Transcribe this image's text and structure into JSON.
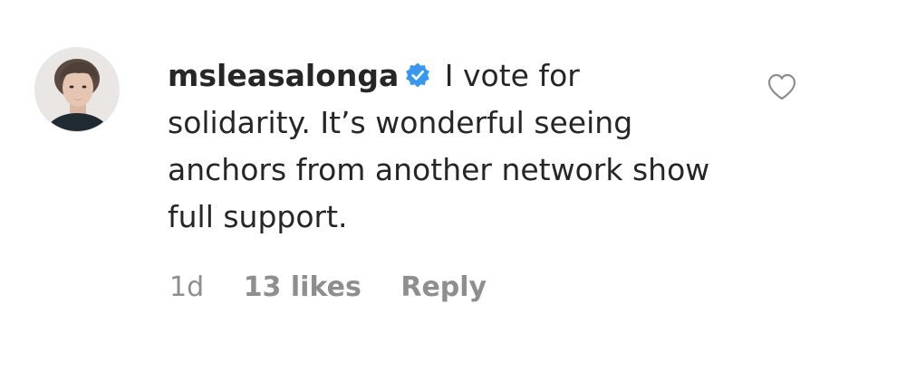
{
  "comment": {
    "username": "msleasalonga",
    "verified": true,
    "text": "I vote for solidarity. It’s wonderful seeing anchors from another network show full support.",
    "time": "1d",
    "likes": "13 likes",
    "reply_label": "Reply"
  },
  "icons": {
    "verified": "verified-badge-icon",
    "like": "heart-outline-icon"
  },
  "colors": {
    "verified_blue": "#3897f0",
    "meta_gray": "#8e8e8e",
    "text": "#262626"
  }
}
